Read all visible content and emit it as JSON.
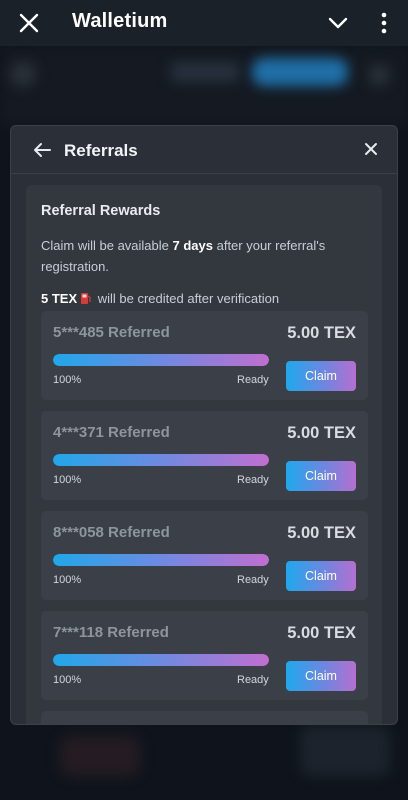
{
  "app": {
    "title": "Walletium"
  },
  "modal": {
    "title": "Referrals",
    "card": {
      "title": "Referral Rewards",
      "info_pre": "Claim will be available ",
      "info_bold": "7 days",
      "info_post": " after your referral's registration.",
      "credit_bold": "5 TEX",
      "credit_icon": "fuel-pump-icon",
      "credit_post": " will be credited after verification"
    },
    "referrals": [
      {
        "name": "5***485 Referred",
        "amount": "5.00 TEX",
        "progress": 100,
        "progress_label": "100%",
        "status": "Ready",
        "claim_label": "Claim"
      },
      {
        "name": "4***371 Referred",
        "amount": "5.00 TEX",
        "progress": 100,
        "progress_label": "100%",
        "status": "Ready",
        "claim_label": "Claim"
      },
      {
        "name": "8***058 Referred",
        "amount": "5.00 TEX",
        "progress": 100,
        "progress_label": "100%",
        "status": "Ready",
        "claim_label": "Claim"
      },
      {
        "name": "7***118 Referred",
        "amount": "5.00 TEX",
        "progress": 100,
        "progress_label": "100%",
        "status": "Ready",
        "claim_label": "Claim"
      }
    ]
  },
  "colors": {
    "accent_start": "#1fa8ee",
    "accent_end": "#b56fd1",
    "modal_bg": "#2b3038",
    "card_bg": "#33383f",
    "item_bg": "#3b4048"
  }
}
